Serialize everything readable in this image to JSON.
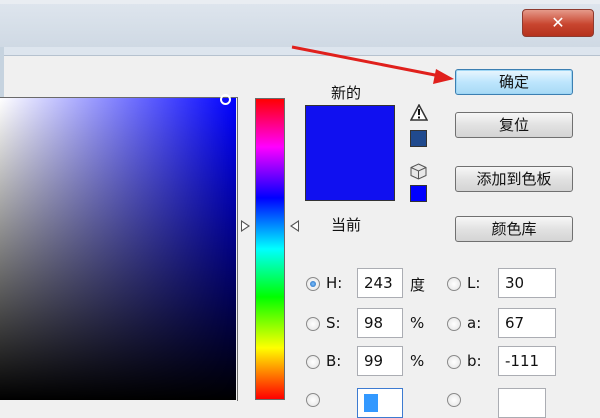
{
  "dialog": {
    "close_label": "✕"
  },
  "preview": {
    "new_label": "新的",
    "current_label": "当前",
    "new_color": "#1010f0",
    "gamut_swatch_color": "#204a8e",
    "web_swatch_color": "#0000ff"
  },
  "buttons": {
    "ok": "确定",
    "reset": "复位",
    "add_to_swatches": "添加到色板",
    "color_libraries": "颜色库"
  },
  "hsb": {
    "h": {
      "label": "H:",
      "value": "243",
      "unit": "度"
    },
    "s": {
      "label": "S:",
      "value": "98",
      "unit": "%"
    },
    "b": {
      "label": "B:",
      "value": "99",
      "unit": "%"
    }
  },
  "lab": {
    "l": {
      "label": "L:",
      "value": "30"
    },
    "a": {
      "label": "a:",
      "value": "67"
    },
    "b": {
      "label": "b:",
      "value": "-111"
    }
  },
  "annotation_color": "#e0201c"
}
